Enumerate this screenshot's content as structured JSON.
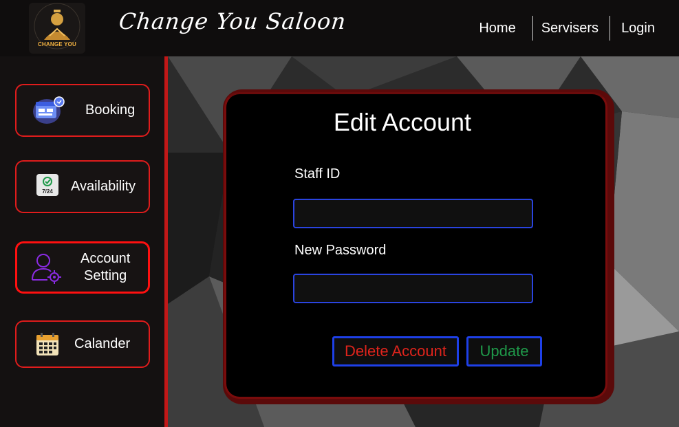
{
  "header": {
    "logo_text": "CHANGE YOU",
    "brand_title": "Change You Saloon",
    "nav": [
      {
        "label": "Home"
      },
      {
        "label": "Servisers"
      },
      {
        "label": "Login"
      }
    ]
  },
  "sidebar": {
    "items": [
      {
        "label": "Booking",
        "icon": "booking-icon"
      },
      {
        "label": "Availability",
        "icon": "availability-icon",
        "icon_text": "7/24"
      },
      {
        "label_line1": "Account",
        "label_line2": "Setting",
        "icon": "account-setting-icon",
        "active": true
      },
      {
        "label": "Calander",
        "icon": "calendar-icon"
      }
    ]
  },
  "form": {
    "title": "Edit Account",
    "staff_id_label": "Staff ID",
    "staff_id_value": "",
    "password_label": "New Password",
    "password_value": "",
    "delete_label": "Delete Account",
    "update_label": "Update"
  },
  "colors": {
    "accent_red": "#e01c1c",
    "input_border": "#2a44e0",
    "delete_text": "#e0241c",
    "update_text": "#1f9a4a"
  }
}
